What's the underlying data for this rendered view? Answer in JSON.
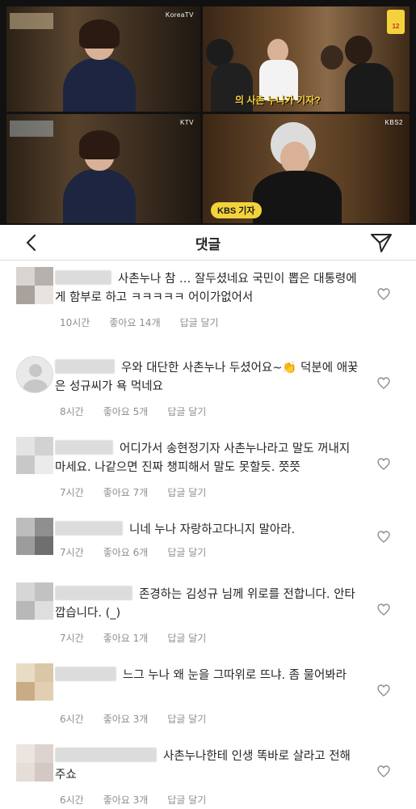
{
  "media": {
    "top_left_logo": "KoreaTV",
    "bottom_left_logo": "KTV",
    "top_right_badge": "12",
    "bottom_right_logo": "KBS2",
    "top_right_caption": "의 사촌 누나가 기자?",
    "bottom_right_bubble": "KBS 기자"
  },
  "header": {
    "title": "댓글",
    "back_icon": "chevron-left-icon",
    "share_icon": "paper-plane-icon"
  },
  "comments": [
    {
      "text": "사촌누나 참 … 잘두셨네요  국민이 뽑은 대통령에게 함부로 하고 ㅋㅋㅋㅋㅋ 어이가없어서",
      "time": "10시간",
      "likes": "좋아요 14개",
      "reply": "답글 달기",
      "avatar_colors": [
        "#d9d4d1",
        "#b7b1ad",
        "#a9a19c",
        "#e7e3e0"
      ]
    },
    {
      "text": "우와 대단한 사촌누나 두셨어요~👏 덕분에 애꿎은 성규씨가 욕 먹네요",
      "time": "8시간",
      "likes": "좋아요 5개",
      "reply": "답글 달기",
      "avatar_colors": []
    },
    {
      "text": "어디가서 송현정기자 사촌누나라고 말도 꺼내지마세요. 나같으면 진짜 챙피해서 말도 못할듯. 쯧쯧",
      "time": "7시간",
      "likes": "좋아요 7개",
      "reply": "답글 달기",
      "avatar_colors": [
        "#e4e4e4",
        "#d2d2d2",
        "#c8c8c8",
        "#ebebeb"
      ]
    },
    {
      "text": "니네 누나 자랑하고다니지 말아라.",
      "time": "7시간",
      "likes": "좋아요 6개",
      "reply": "답글 달기",
      "avatar_colors": [
        "#bdbdbd",
        "#8f8f8f",
        "#9c9c9c",
        "#6f6f6f"
      ]
    },
    {
      "text": "존경하는 김성규 님께 위로를 전합니다. 안타깝습니다. (_)",
      "time": "7시간",
      "likes": "좋아요 1개",
      "reply": "답글 달기",
      "avatar_colors": [
        "#d6d6d6",
        "#c2c2c2",
        "#b8b8b8",
        "#dedede"
      ]
    },
    {
      "text": "느그 누나 왜 눈을 그따위로 뜨냐. 좀 물어봐라",
      "time": "6시간",
      "likes": "좋아요 3개",
      "reply": "답글 달기",
      "avatar_colors": [
        "#e8dcc6",
        "#d9c7a8",
        "#c9ab86",
        "#e2cfb2"
      ]
    },
    {
      "text": "사촌누나한테 인생 똑바로 살라고 전해주쇼",
      "time": "6시간",
      "likes": "좋아요 3개",
      "reply": "답글 달기",
      "avatar_colors": [
        "#ece4e0",
        "#dcd3ce",
        "#e6ddd8",
        "#d3c8c2"
      ]
    }
  ]
}
